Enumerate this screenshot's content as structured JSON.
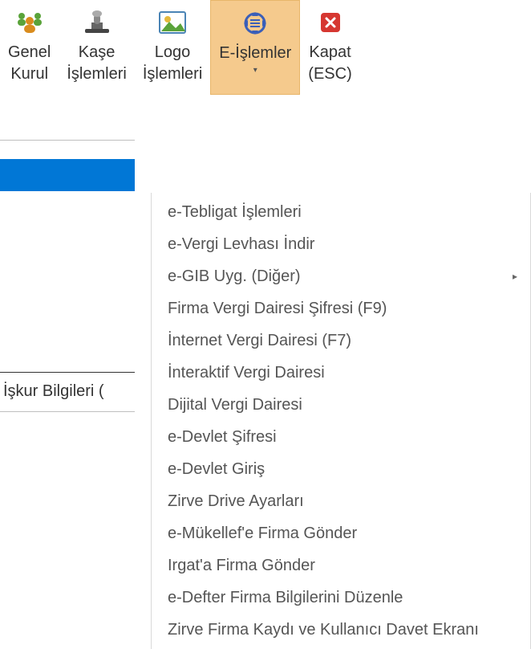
{
  "toolbar": {
    "items": [
      {
        "label": "Genel\nKurul"
      },
      {
        "label": "Kaşe\nİşlemleri"
      },
      {
        "label": "Logo\nİşlemleri"
      },
      {
        "label": "E-İşlemler"
      },
      {
        "label": "Kapat\n(ESC)"
      }
    ]
  },
  "sidebar": {
    "iskur_label": "İşkur Bilgileri ("
  },
  "menu": {
    "items": [
      {
        "label": "e-Tebligat İşlemleri",
        "submenu": false
      },
      {
        "label": "e-Vergi Levhası İndir",
        "submenu": false
      },
      {
        "label": "e-GIB Uyg. (Diğer)",
        "submenu": true
      },
      {
        "label": "Firma Vergi Dairesi Şifresi (F9)",
        "submenu": false
      },
      {
        "label": "İnternet Vergi Dairesi (F7)",
        "submenu": false
      },
      {
        "label": "İnteraktif Vergi Dairesi",
        "submenu": false
      },
      {
        "label": "Dijital Vergi Dairesi",
        "submenu": false
      },
      {
        "label": "e-Devlet Şifresi",
        "submenu": false
      },
      {
        "label": "e-Devlet Giriş",
        "submenu": false
      },
      {
        "label": "Zirve Drive Ayarları",
        "submenu": false
      },
      {
        "label": "e-Mükellef'e Firma Gönder",
        "submenu": false
      },
      {
        "label": "Irgat'a Firma Gönder",
        "submenu": false
      },
      {
        "label": "e-Defter Firma Bilgilerini Düzenle",
        "submenu": false
      },
      {
        "label": "Zirve Firma Kaydı ve Kullanıcı Davet Ekranı",
        "submenu": false
      }
    ]
  }
}
